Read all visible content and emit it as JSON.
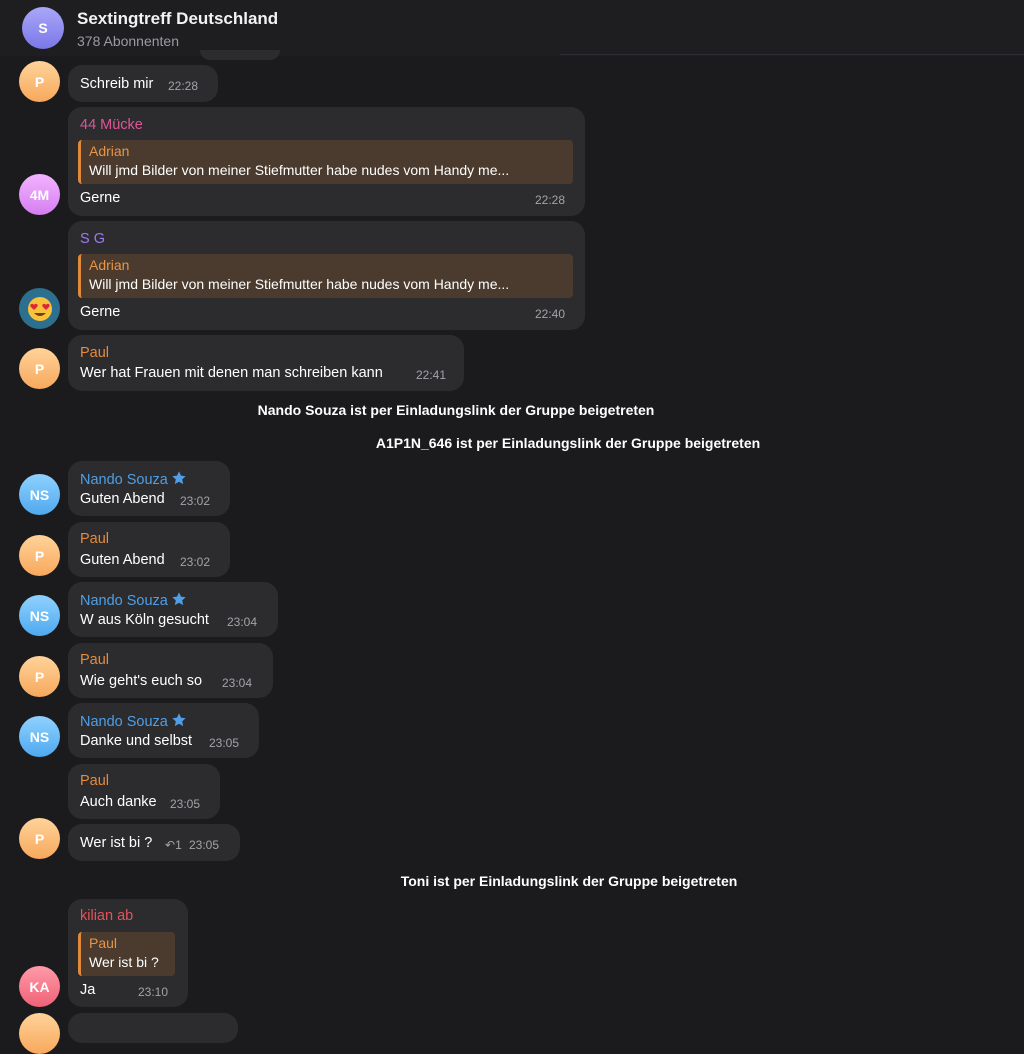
{
  "header": {
    "avatar_letter": "S",
    "title": "Sextingtreff Deutschland",
    "subtitle": "378 Abonnenten"
  },
  "messages": [
    {
      "avatar": "P",
      "text": "Schreib mir",
      "time": "22:28"
    },
    {
      "avatar": "4M",
      "sender": "44 Mücke",
      "quote_name": "Adrian",
      "quote_text": "Will jmd Bilder von meiner Stiefmutter habe nudes vom Handy me...",
      "text": "Gerne",
      "time": "22:28"
    },
    {
      "avatar_icon": "smiling-heart-eyes-emoji",
      "sender": "S G",
      "quote_name": "Adrian",
      "quote_text": "Will jmd Bilder von meiner Stiefmutter habe nudes vom Handy me...",
      "text": "Gerne",
      "time": "22:40"
    },
    {
      "avatar": "P",
      "sender": "Paul",
      "text": "Wer hat Frauen mit denen man schreiben kann",
      "time": "22:41"
    },
    {
      "avatar": "NS",
      "sender": "Nando Souza",
      "text": "Guten Abend",
      "time": "23:02"
    },
    {
      "avatar": "P",
      "sender": "Paul",
      "text": "Guten Abend",
      "time": "23:02"
    },
    {
      "avatar": "NS",
      "sender": "Nando Souza",
      "text": "W aus Köln gesucht",
      "time": "23:04"
    },
    {
      "avatar": "P",
      "sender": "Paul",
      "text": "Wie geht's euch so",
      "time": "23:04"
    },
    {
      "avatar": "NS",
      "sender": "Nando Souza",
      "text": "Danke und selbst",
      "time": "23:05"
    },
    {
      "sender": "Paul",
      "text": "Auch danke",
      "time": "23:05"
    },
    {
      "avatar": "P",
      "text": "Wer ist bi ?",
      "replies": "1",
      "time": "23:05"
    },
    {
      "avatar": "KA",
      "sender": "kilian ab",
      "quote_name": "Paul",
      "quote_text": "Wer ist bi ?",
      "text": "Ja",
      "time": "23:10"
    }
  ],
  "service": [
    "Nando Souza ist per Einladungslink der Gruppe beigetreten",
    "A1P1N_646 ist per Einladungslink der Gruppe beigetreten",
    "Toni ist per Einladungslink der Gruppe beigetreten"
  ],
  "colors": {
    "background": "#1b1b1d",
    "bubble": "#2c2c2e",
    "name_orange": "#e58a3e",
    "name_blue": "#4f9ee6",
    "name_pink": "#e0559a",
    "name_purple": "#9c7bf0",
    "name_red": "#e2545b"
  },
  "icons": {
    "star": "star-icon",
    "reply": "reply-arrow-icon"
  }
}
